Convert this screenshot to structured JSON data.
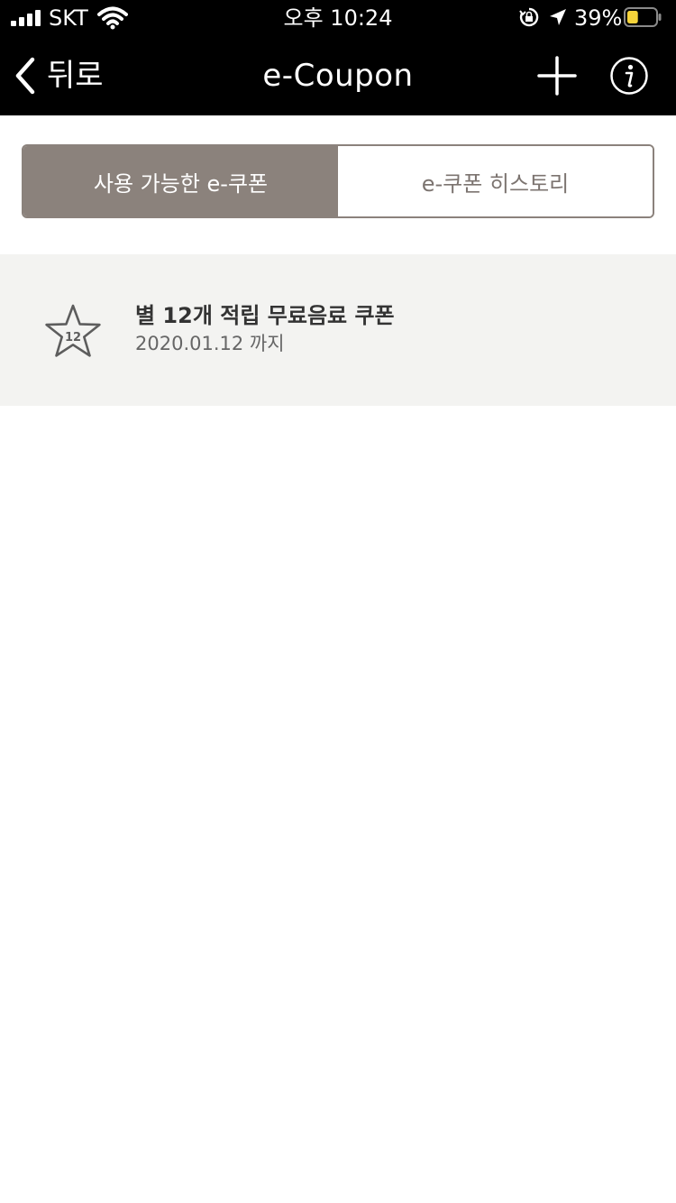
{
  "status_bar": {
    "carrier": "SKT",
    "time": "오후 10:24",
    "battery_percent": "39%",
    "battery_level": 0.39,
    "icons": [
      "signal-icon",
      "wifi-icon",
      "orientation-lock-icon",
      "location-arrow-icon",
      "battery-icon"
    ]
  },
  "nav": {
    "back_label": "뒤로",
    "title": "e-Coupon",
    "icons": [
      "chevron-left-icon",
      "plus-icon",
      "info-icon"
    ]
  },
  "tabs": [
    {
      "label": "사용 가능한 e-쿠폰",
      "active": true
    },
    {
      "label": "e-쿠폰 히스토리",
      "active": false
    }
  ],
  "coupons": [
    {
      "icon": "star-12-icon",
      "badge": "12",
      "name": "별 12개 적립 무료음료 쿠폰",
      "expiry": "2020.01.12 까지"
    }
  ],
  "colors": {
    "header_bg": "#000000",
    "tab_active_bg": "#8b827c",
    "tab_inactive_text": "#7c7470",
    "coupon_bg": "#f3f3f1",
    "battery_fill": "#f5d33a"
  }
}
